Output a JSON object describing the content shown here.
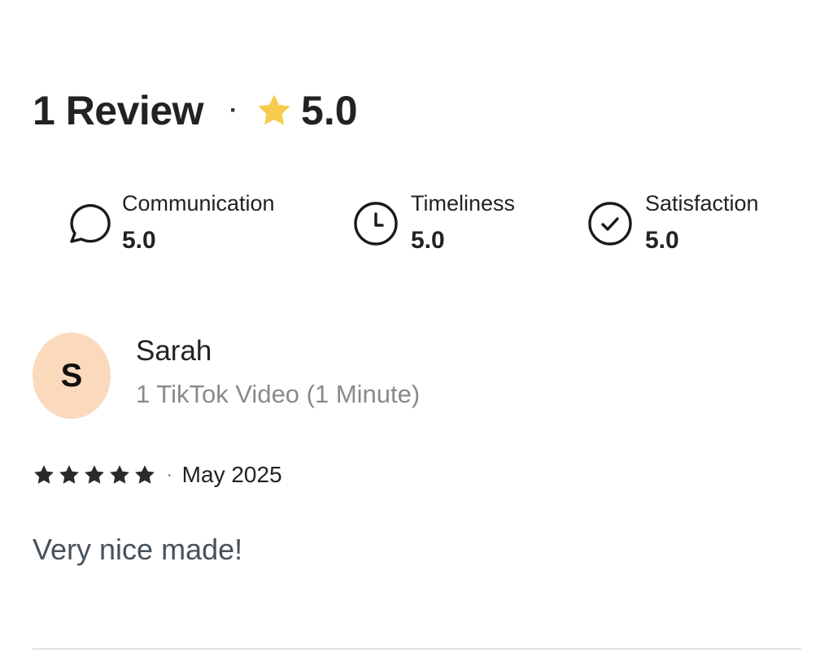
{
  "summary": {
    "review_count_label": "1 Review",
    "separator": "·",
    "overall_score": "5.0",
    "star_color": "#F7CB4D"
  },
  "ratings": [
    {
      "label": "Communication",
      "value": "5.0",
      "icon": "chat-bubble-icon"
    },
    {
      "label": "Timeliness",
      "value": "5.0",
      "icon": "clock-icon"
    },
    {
      "label": "Satisfaction",
      "value": "5.0",
      "icon": "check-circle-icon"
    }
  ],
  "review": {
    "avatar_initial": "S",
    "avatar_color": "#FAD9BD",
    "name": "Sarah",
    "service": "1 TikTok Video (1 Minute)",
    "stars": 5,
    "separator": "·",
    "date": "May 2025",
    "text": "Very nice made!"
  }
}
